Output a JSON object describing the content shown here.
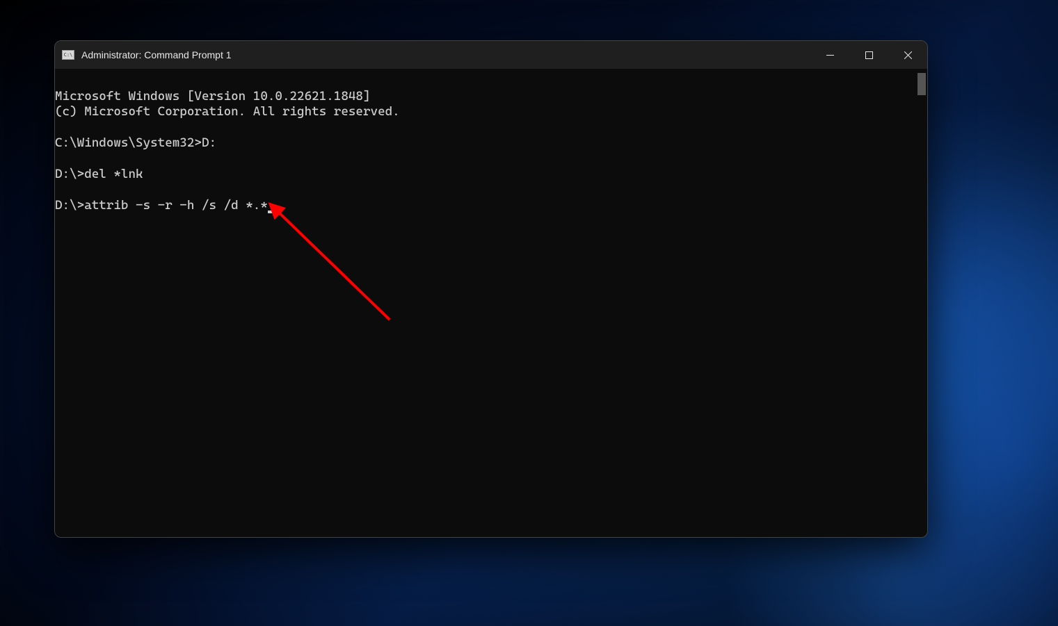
{
  "window": {
    "title": "Administrator: Command Prompt 1",
    "icon_label": "cmd-icon"
  },
  "terminal": {
    "lines": [
      "Microsoft Windows [Version 10.0.22621.1848]",
      "(c) Microsoft Corporation. All rights reserved.",
      "",
      "C:\\Windows\\System32>D:",
      "",
      "D:\\>del *lnk",
      "",
      "D:\\>attrib -s -r -h /s /d *.*"
    ],
    "current_input_line_index": 7
  },
  "controls": {
    "minimize": "Minimize",
    "maximize": "Maximize",
    "close": "Close"
  },
  "annotation": {
    "type": "arrow",
    "color": "#ff0000"
  }
}
